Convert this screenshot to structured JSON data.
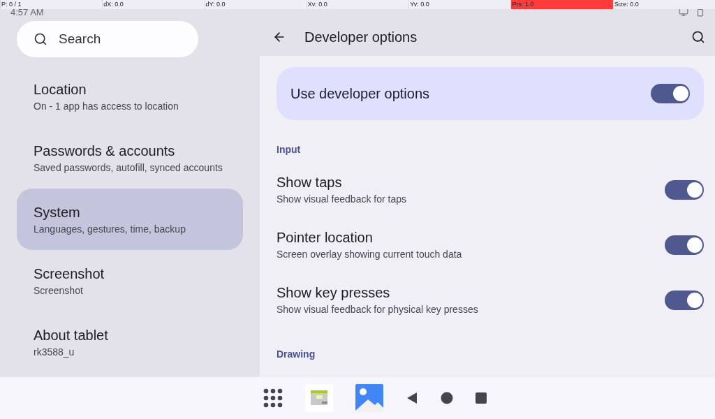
{
  "pointer_overlay": [
    {
      "text": "P: 0 / 1",
      "alert": false
    },
    {
      "text": "dX: 0.0",
      "alert": false
    },
    {
      "text": "dY: 0.0",
      "alert": false
    },
    {
      "text": "Xv: 0.0",
      "alert": false
    },
    {
      "text": "Yv: 0.0",
      "alert": false
    },
    {
      "text": "Prs: 1.0",
      "alert": true
    },
    {
      "text": "Size: 0.0",
      "alert": false
    }
  ],
  "status_bar": {
    "time": "4:57 AM"
  },
  "search": {
    "placeholder": "Search"
  },
  "sidebar": {
    "items": [
      {
        "title": "Location",
        "subtitle": "On - 1 app has access to location",
        "selected": false
      },
      {
        "title": "Passwords & accounts",
        "subtitle": "Saved passwords, autofill, synced accounts",
        "selected": false
      },
      {
        "title": "System",
        "subtitle": "Languages, gestures, time, backup",
        "selected": true
      },
      {
        "title": "Screenshot",
        "subtitle": "Screenshot",
        "selected": false
      },
      {
        "title": "About tablet",
        "subtitle": "rk3588_u",
        "selected": false
      }
    ]
  },
  "header": {
    "title": "Developer options"
  },
  "master_switch": {
    "label": "Use developer options",
    "on": true
  },
  "sections": [
    {
      "heading": "Input",
      "items": [
        {
          "title": "Show taps",
          "subtitle": "Show visual feedback for taps",
          "on": true
        },
        {
          "title": "Pointer location",
          "subtitle": "Screen overlay showing current touch data",
          "on": true
        },
        {
          "title": "Show key presses",
          "subtitle": "Show visual feedback for physical key presses",
          "on": true
        }
      ]
    },
    {
      "heading": "Drawing"
    }
  ],
  "nav_bar": {
    "apps": [
      {
        "kind": "grid"
      },
      {
        "kind": "calendar"
      },
      {
        "kind": "gallery"
      }
    ]
  }
}
